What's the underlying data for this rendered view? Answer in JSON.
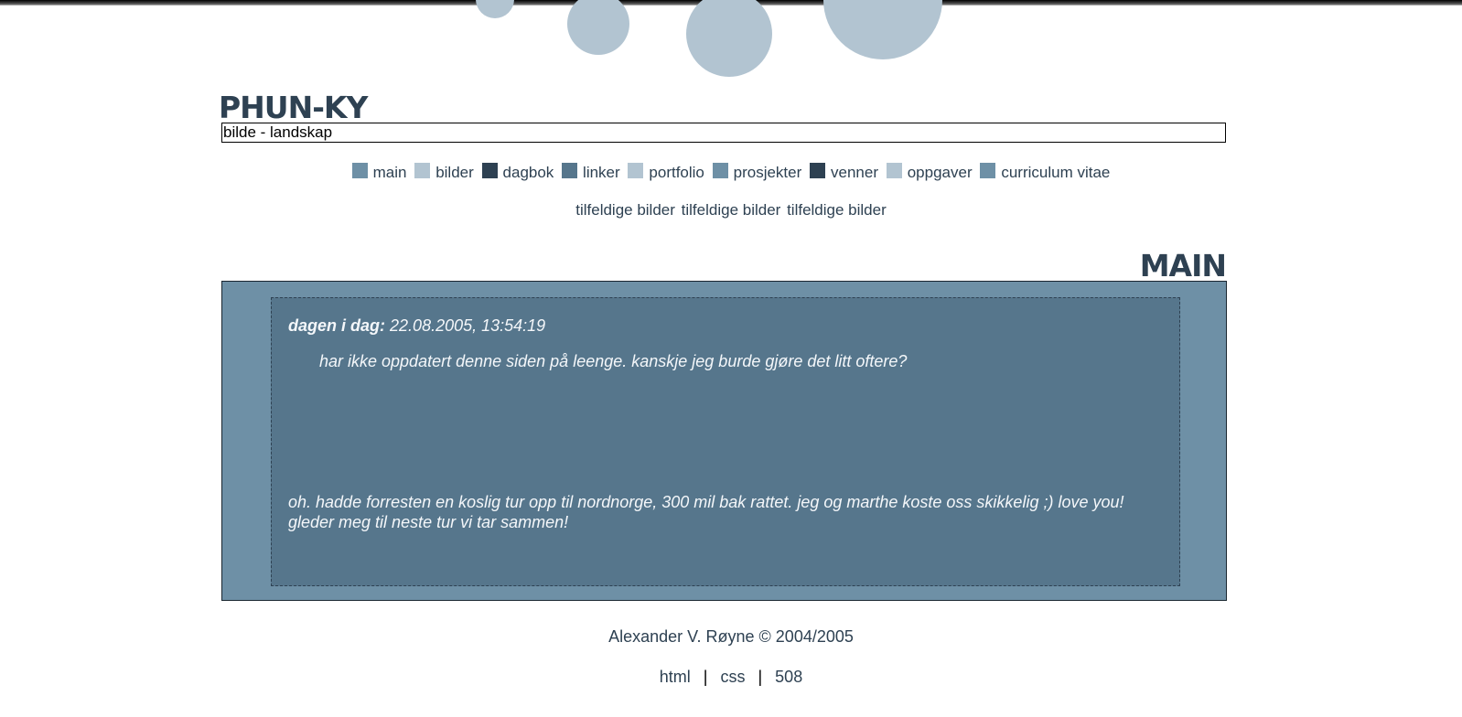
{
  "site": {
    "logo": "PHUN-KY",
    "search_value": "bilde - landskap"
  },
  "nav": {
    "items": [
      {
        "label": "main",
        "color": "#6e90a6"
      },
      {
        "label": "bilder",
        "color": "#b2c4d1"
      },
      {
        "label": "dagbok",
        "color": "#2e4152"
      },
      {
        "label": "linker",
        "color": "#56768c"
      },
      {
        "label": "portfolio",
        "color": "#b2c4d1"
      },
      {
        "label": "prosjekter",
        "color": "#6e90a6"
      },
      {
        "label": "venner",
        "color": "#2e4152"
      },
      {
        "label": "oppgaver",
        "color": "#b2c4d1"
      },
      {
        "label": "curriculum vitae",
        "color": "#6e90a6"
      }
    ],
    "random_links": [
      "tilfeldige bilder",
      "tilfeldige bilder",
      "tilfeldige bilder"
    ]
  },
  "main": {
    "section_title": "MAIN",
    "date_label": "dagen i dag:",
    "date_value": "22.08.2005, 13:54:19",
    "paragraph1": "har ikke oppdatert denne siden på leenge. kanskje jeg burde gjøre det litt oftere?",
    "paragraph2": "oh. hadde forresten en koslig tur opp til nordnorge, 300 mil bak rattet. jeg og marthe koste oss skikkelig ;) love you! gleder meg til neste tur vi tar sammen!"
  },
  "footer": {
    "copyright": "Alexander V. Røyne © 2004/2005",
    "links": [
      "html",
      "css",
      "508"
    ],
    "separator": "|"
  },
  "colors": {
    "dark": "#2e4152",
    "mid": "#56768c",
    "light": "#6e90a6",
    "pale": "#b2c4d1"
  }
}
